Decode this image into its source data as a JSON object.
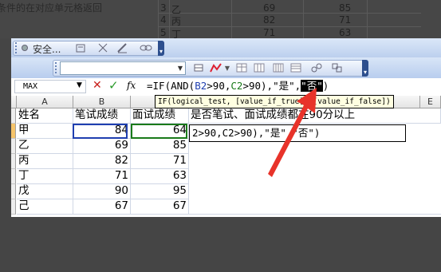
{
  "background": {
    "caption": "条件的在对应单元格返回",
    "rows": [
      {
        "num": "3",
        "name": "乙",
        "a": "69",
        "b": "85"
      },
      {
        "num": "4",
        "name": "丙",
        "a": "82",
        "b": "71"
      },
      {
        "num": "5",
        "name": "丁",
        "a": "71",
        "b": "63"
      }
    ]
  },
  "toolbar": {
    "security_label": "安全...",
    "icons": [
      "security-icon",
      "tools-icon",
      "scissors-icon",
      "edit-icon",
      "link-icon"
    ],
    "dropdown_value": ""
  },
  "formula_bar": {
    "name_box": "MAX",
    "cancel_symbol": "✕",
    "enter_symbol": "✓",
    "fx_label": "fx",
    "formula_parts": {
      "p1": "=IF(AND(",
      "p2": "B2",
      "p3": ">90,",
      "p4": "C2",
      "p5": ">90),\"是\",",
      "p6": "\"否\"",
      "p7": ")"
    }
  },
  "tooltip": {
    "func": "IF",
    "args": "(logical_test, [value_if_true], [value_if_false])"
  },
  "columns": [
    "A",
    "B",
    "C",
    "D",
    "E"
  ],
  "table": {
    "header": [
      "姓名",
      "笔试成绩",
      "面试成绩",
      "是否笔试、面试成绩都在90分以上"
    ],
    "rows": [
      {
        "name": "甲",
        "written": "84",
        "interview": "64"
      },
      {
        "name": "乙",
        "written": "69",
        "interview": "85"
      },
      {
        "name": "丙",
        "written": "82",
        "interview": "71"
      },
      {
        "name": "丁",
        "written": "71",
        "interview": "63"
      },
      {
        "name": "戊",
        "written": "90",
        "interview": "95"
      },
      {
        "name": "己",
        "written": "67",
        "interview": "67"
      }
    ]
  },
  "editor_text": "2>90,C2>90),\"是\",\"否\")",
  "colors": {
    "arrow": "#e8332a",
    "ref_b": "#1f3fb0",
    "ref_c": "#1a7a1a"
  }
}
